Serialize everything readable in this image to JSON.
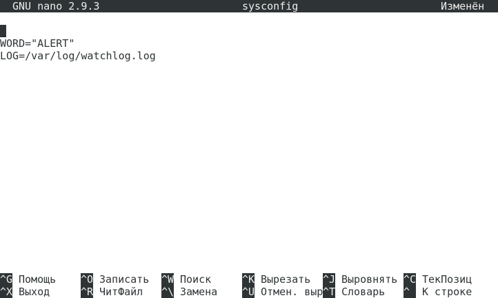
{
  "titlebar": {
    "app": "GNU nano 2.9.3",
    "filename": "sysconfig",
    "status": "Изменён"
  },
  "editor": {
    "lines": [
      "",
      "WORD=\"ALERT\"",
      "LOG=/var/log/watchlog.log"
    ]
  },
  "shortcuts": {
    "row1": [
      {
        "key": "^G",
        "label": "Помощь"
      },
      {
        "key": "^O",
        "label": "Записать"
      },
      {
        "key": "^W",
        "label": "Поиск"
      },
      {
        "key": "^K",
        "label": "Вырезать"
      },
      {
        "key": "^J",
        "label": "Выровнять"
      },
      {
        "key": "^C",
        "label": "ТекПозиц"
      }
    ],
    "row2": [
      {
        "key": "^X",
        "label": "Выход"
      },
      {
        "key": "^R",
        "label": "ЧитФайл"
      },
      {
        "key": "^\\",
        "label": "Замена"
      },
      {
        "key": "^U",
        "label": "Отмен. выр"
      },
      {
        "key": "^T",
        "label": "Словарь"
      },
      {
        "key": "^ ",
        "label": "К строке"
      }
    ]
  }
}
